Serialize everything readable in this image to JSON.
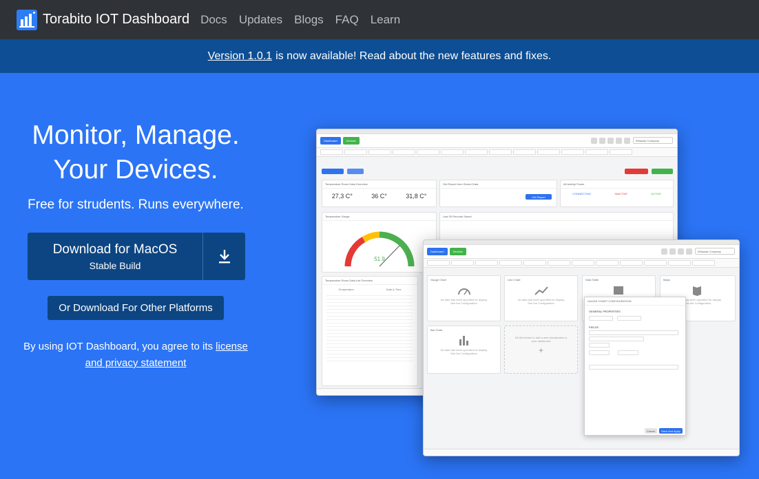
{
  "nav": {
    "brand": "Torabito IOT Dashboard",
    "links": [
      "Docs",
      "Updates",
      "Blogs",
      "FAQ",
      "Learn"
    ]
  },
  "banner": {
    "version_link": "Version 1.0.1",
    "message": "is now available! Read about the new features and fixes."
  },
  "hero": {
    "title_line1": "Monitor, Manage.",
    "title_line2": "Your Devices.",
    "subtitle": "Free for strudents. Runs everywhere.",
    "download_main": "Download for MacOS",
    "download_sub": "Stable Build",
    "download_other": "Or Download For Other Platforms",
    "terms_prefix": "By using IOT Dashboard, you agree to its",
    "terms_link": "license and privacy statement"
  },
  "mock_back": {
    "dashboard_tab": "Dashboard",
    "devices_tab": "Devices",
    "company": "Whaaaw Company",
    "temp_card_title": "Temperature Room Data Overview",
    "temp_values": [
      "27,3 C°",
      "36 C°",
      "31,8 C°"
    ],
    "export_card_title": "Get Report from Stored Data",
    "export_button": "Get Report",
    "activity_title": "All Activity Power",
    "stat_labels": [
      "CONNECTING",
      "INACTIVE",
      "ACTIVE"
    ],
    "gauge_title": "Temperature Gauge",
    "gauge_value": "51.9",
    "line_title": "Last 30 Records Saved",
    "table_title": "Temperature Room Data List Overview",
    "table_headers": [
      "Temperature",
      "Date & Time"
    ],
    "colors": {
      "accent": "#2e72ee",
      "green": "#41b34a",
      "red": "#e53935",
      "gauge_green": "#4caf50",
      "gauge_yellow": "#ffc107"
    }
  },
  "mock_front": {
    "dashboard_tab": "Dashboard",
    "devices_tab": "Devices",
    "company": "Whaaaw Company",
    "widgets": [
      "Gauge Chart",
      "Line Chart",
      "Data Table",
      "Maps",
      "Bar Chart"
    ],
    "empty_text": "No data has been specified for display",
    "config_text": "See the Configuration",
    "add_widget_text": "Hit this button to add a new visualization in your dashboard",
    "modal_title": "GAUGE CHART CONFIGURATION",
    "modal_section_general": "GENERAL PROPERTIES",
    "modal_section_fields": "FIELDS",
    "modal_cancel": "Cancel",
    "modal_save": "Save And Apply"
  }
}
